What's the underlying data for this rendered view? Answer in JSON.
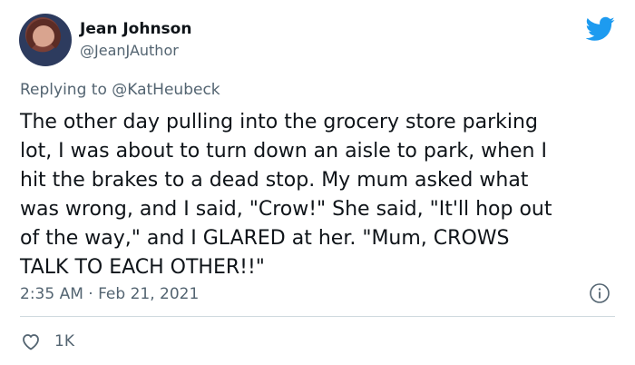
{
  "author": {
    "display_name": "Jean Johnson",
    "handle": "@JeanJAuthor"
  },
  "reply": {
    "prefix": "Replying to ",
    "mention": "@KatHeubeck"
  },
  "tweet": {
    "lines": [
      "The other day pulling into the grocery store parking",
      "lot, I was about to turn down an aisle to park, when I",
      "hit the brakes to a dead stop. My mum asked what",
      "was wrong, and I said, \"Crow!\" She said, \"It'll hop out",
      "of the way,\" and I GLARED at her. \"Mum, CROWS",
      "TALK TO EACH OTHER!!\""
    ],
    "timestamp": "2:35 AM · Feb 21, 2021"
  },
  "actions": {
    "like_count": "1K"
  },
  "icons": {
    "brand": "twitter-bird-icon",
    "info": "info-icon",
    "like": "heart-icon"
  },
  "colors": {
    "brand_blue": "#1d9bf0",
    "secondary_text": "#536471",
    "primary_text": "#0f1419",
    "divider": "#cfd9de"
  }
}
